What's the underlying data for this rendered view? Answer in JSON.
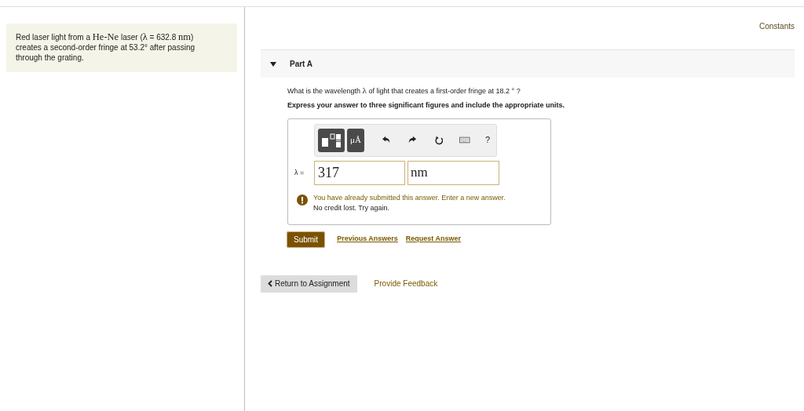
{
  "problem": {
    "segments": [
      {
        "kind": "text",
        "text": "Red laser light from a "
      },
      {
        "kind": "math",
        "text": "He-Ne"
      },
      {
        "kind": "text",
        "text": " laser ("
      },
      {
        "kind": "math",
        "text": "λ"
      },
      {
        "kind": "text",
        "text": " = 632.8 "
      },
      {
        "kind": "math",
        "text": "nm"
      },
      {
        "kind": "text",
        "text": ") creates a second-order fringe at 53.2° after passing through the grating."
      }
    ]
  },
  "constants_link": "Constants",
  "part": {
    "title": "Part A",
    "expanded": true,
    "question": [
      {
        "kind": "text",
        "text": "What is the wavelength "
      },
      {
        "kind": "math",
        "text": "λ"
      },
      {
        "kind": "text",
        "text": " of light that creates a first-order fringe at 18.2 ° ?"
      }
    ],
    "instruction": "Express your answer to three significant figures and include the appropriate units.",
    "toolbar": [
      {
        "kind": "templates"
      },
      {
        "kind": "units",
        "label": "μÅ"
      },
      {
        "kind": "undo"
      },
      {
        "kind": "redo"
      },
      {
        "kind": "reset"
      },
      {
        "kind": "keyboard"
      },
      {
        "kind": "help",
        "label": "?"
      }
    ],
    "answer_label": "λ =",
    "value": "317",
    "unit": "nm",
    "feedback": {
      "line1": "You have already submitted this answer. Enter a new answer.",
      "line2": "No credit lost. Try again."
    },
    "submit": "Submit",
    "links": [
      "Previous Answers",
      "Request Answer"
    ]
  },
  "footer": {
    "return": "Return to Assignment",
    "feedback": "Provide Feedback"
  }
}
